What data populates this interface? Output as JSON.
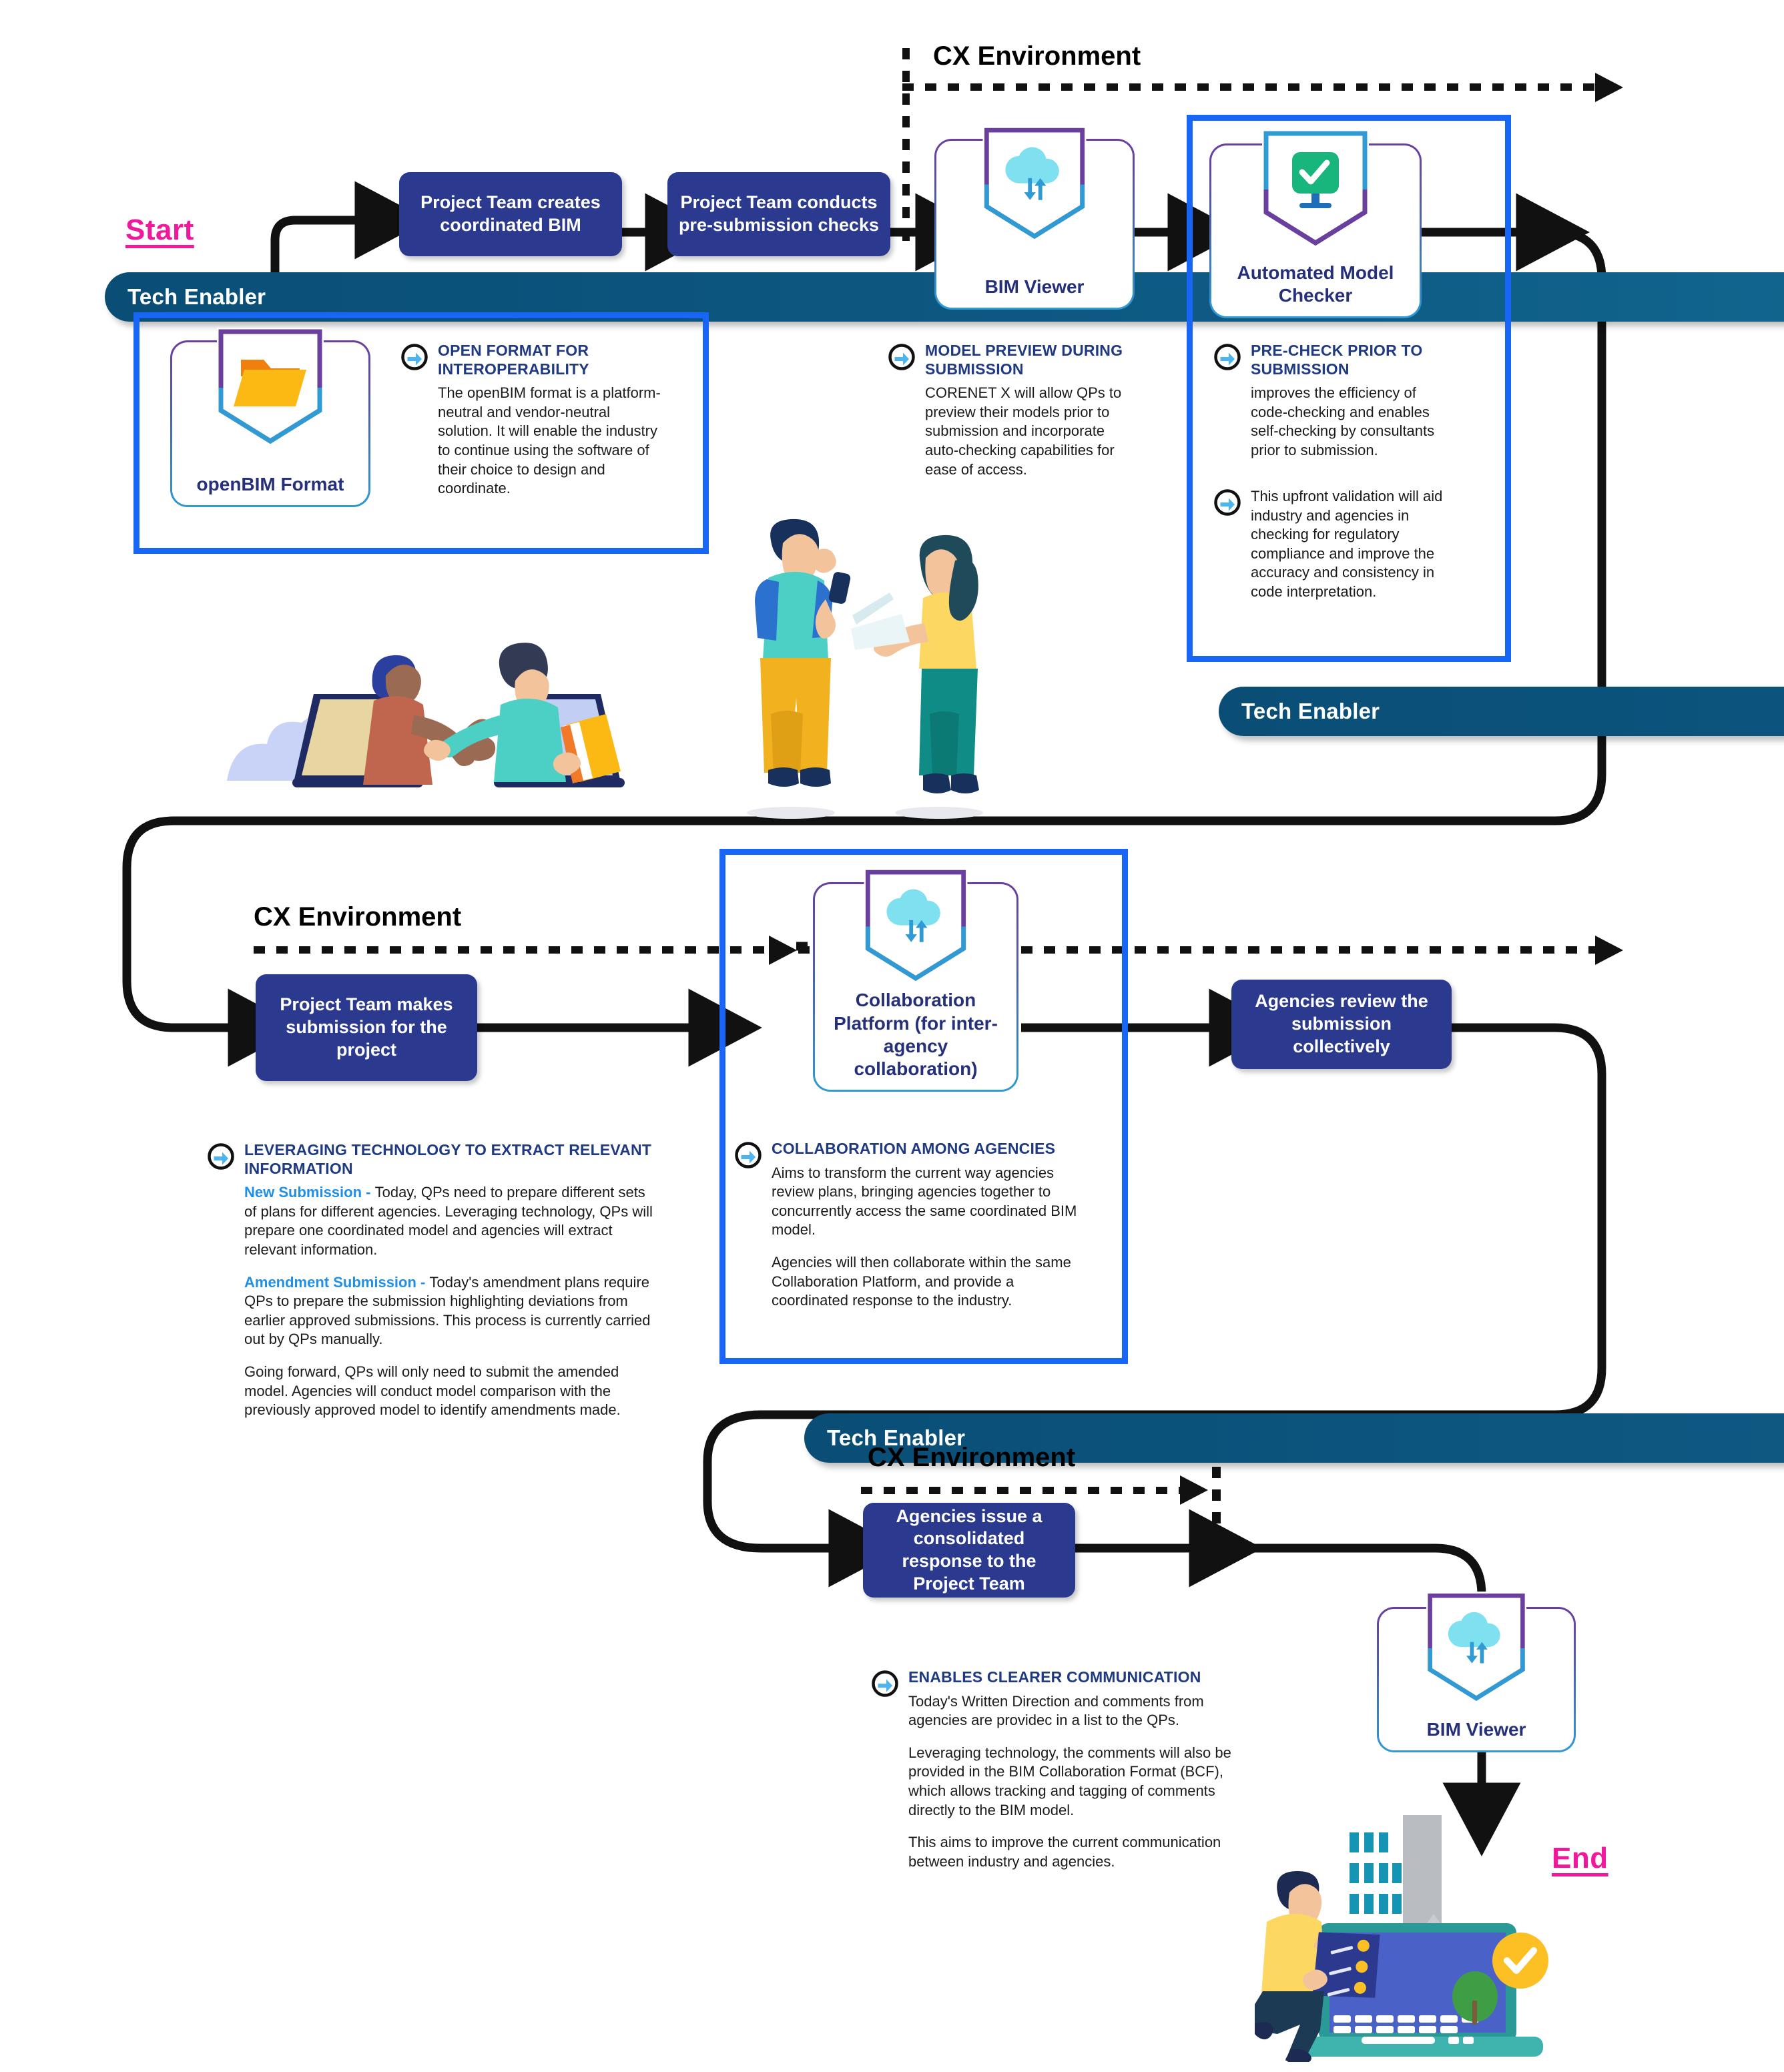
{
  "markers": {
    "start": "Start",
    "end": "End"
  },
  "cx_environment_label": "CX Environment",
  "tech_enabler": {
    "label": "Tech Enabler",
    "icon": "open-folder-icon"
  },
  "row1": {
    "steps": [
      {
        "id": "create-bim",
        "label": "Project Team creates coordinated BIM"
      },
      {
        "id": "pre-submission-checks",
        "label": "Project Team conducts pre-submission checks"
      }
    ],
    "cards": [
      {
        "id": "openbim-format",
        "label": "openBIM Format",
        "icon": "folder-icon"
      },
      {
        "id": "bim-viewer",
        "label": "BIM Viewer",
        "icon": "cloud-sync-icon"
      },
      {
        "id": "automated-model-checker",
        "label": "Automated Model Checker",
        "icon": "monitor-check-icon"
      }
    ],
    "callouts": [
      {
        "id": "open-format-for-interoperability",
        "title": "OPEN FORMAT FOR INTEROPERABILITY",
        "paras": [
          "The openBIM format is a platform-neutral and vendor-neutral solution. It will enable the industry to continue using the software of their choice to design and coordinate."
        ]
      },
      {
        "id": "model-preview-during-submission",
        "title": "MODEL PREVIEW DURING SUBMISSION",
        "paras": [
          "CORENET X will allow QPs to preview their models prior to submission and incorporate auto-checking capabilities for ease of access."
        ]
      },
      {
        "id": "pre-check-prior-to-submission",
        "title": "PRE-CHECK PRIOR TO SUBMISSION",
        "paras": [
          "improves the efficiency of code-checking and enables self-checking by consultants prior to submission."
        ],
        "second_bullet": "This upfront validation will aid industry and agencies in checking for regulatory compliance and improve the accuracy and consistency in code interpretation."
      }
    ]
  },
  "row2": {
    "steps": [
      {
        "id": "makes-submission",
        "label": "Project Team makes submission for the project"
      },
      {
        "id": "agencies-review",
        "label": "Agencies review the submission collectively"
      }
    ],
    "cards": [
      {
        "id": "collaboration-platform",
        "label": "Collaboration Platform (for inter-agency collaboration)",
        "icon": "cloud-sync-icon"
      }
    ],
    "callouts": [
      {
        "id": "leveraging-technology-to-extract-relevant-information",
        "title": "LEVERAGING TECHNOLOGY TO EXTRACT RELEVANT INFORMATION",
        "p1_lead": "New Submission - ",
        "p1": "Today, QPs need to prepare different sets of plans for different agencies. Leveraging technology, QPs will prepare one coordinated model and agencies will extract relevant information.",
        "p2_lead": "Amendment Submission - ",
        "p2": "Today's amendment plans require QPs to prepare the submission highlighting deviations from earlier approved submissions. This process is currently carried out by QPs manually.",
        "p3": "Going forward, QPs will only need to submit the amended model. Agencies will conduct model comparison with the previously approved model to identify amendments made."
      },
      {
        "id": "collaboration-among-agencies",
        "title": "COLLABORATION AMONG AGENCIES",
        "paras": [
          "Aims to transform the current way agencies review plans, bringing agencies together to concurrently access the same coordinated BIM model.",
          "Agencies will then collaborate within the same Collaboration Platform, and provide a coordinated response to the industry."
        ]
      }
    ]
  },
  "row3": {
    "steps": [
      {
        "id": "consolidated-response",
        "label": "Agencies issue a consolidated response to the Project Team"
      }
    ],
    "cards": [
      {
        "id": "bim-viewer-end",
        "label": "BIM Viewer",
        "icon": "cloud-sync-icon"
      }
    ],
    "callouts": [
      {
        "id": "enables-clearer-communication",
        "title": "ENABLES CLEARER COMMUNICATION",
        "paras": [
          "Today's Written Direction and comments from agencies are providec in a list to the QPs.",
          "Leveraging technology, the comments will also be provided in the BIM Collaboration Format (BCF), which allows tracking and tagging of comments directly to the BIM model.",
          "This aims to improve the current communication between industry and agencies."
        ]
      }
    ]
  },
  "illustrations": [
    {
      "id": "handshake-through-laptops-illustration"
    },
    {
      "id": "two-people-with-phone-and-laptop-illustration"
    },
    {
      "id": "person-with-laptop-city-approved-illustration"
    }
  ],
  "colors": {
    "process_box": "#2b3a8f",
    "highlight_frame": "#1766f5",
    "marker": "#f0189b",
    "callout_title": "#1f3a82",
    "callout_lead": "#1f8fe8",
    "pill": "#0e5c86",
    "card_border_top": "#6b3f9e",
    "card_border_bottom": "#2f9ad4"
  }
}
